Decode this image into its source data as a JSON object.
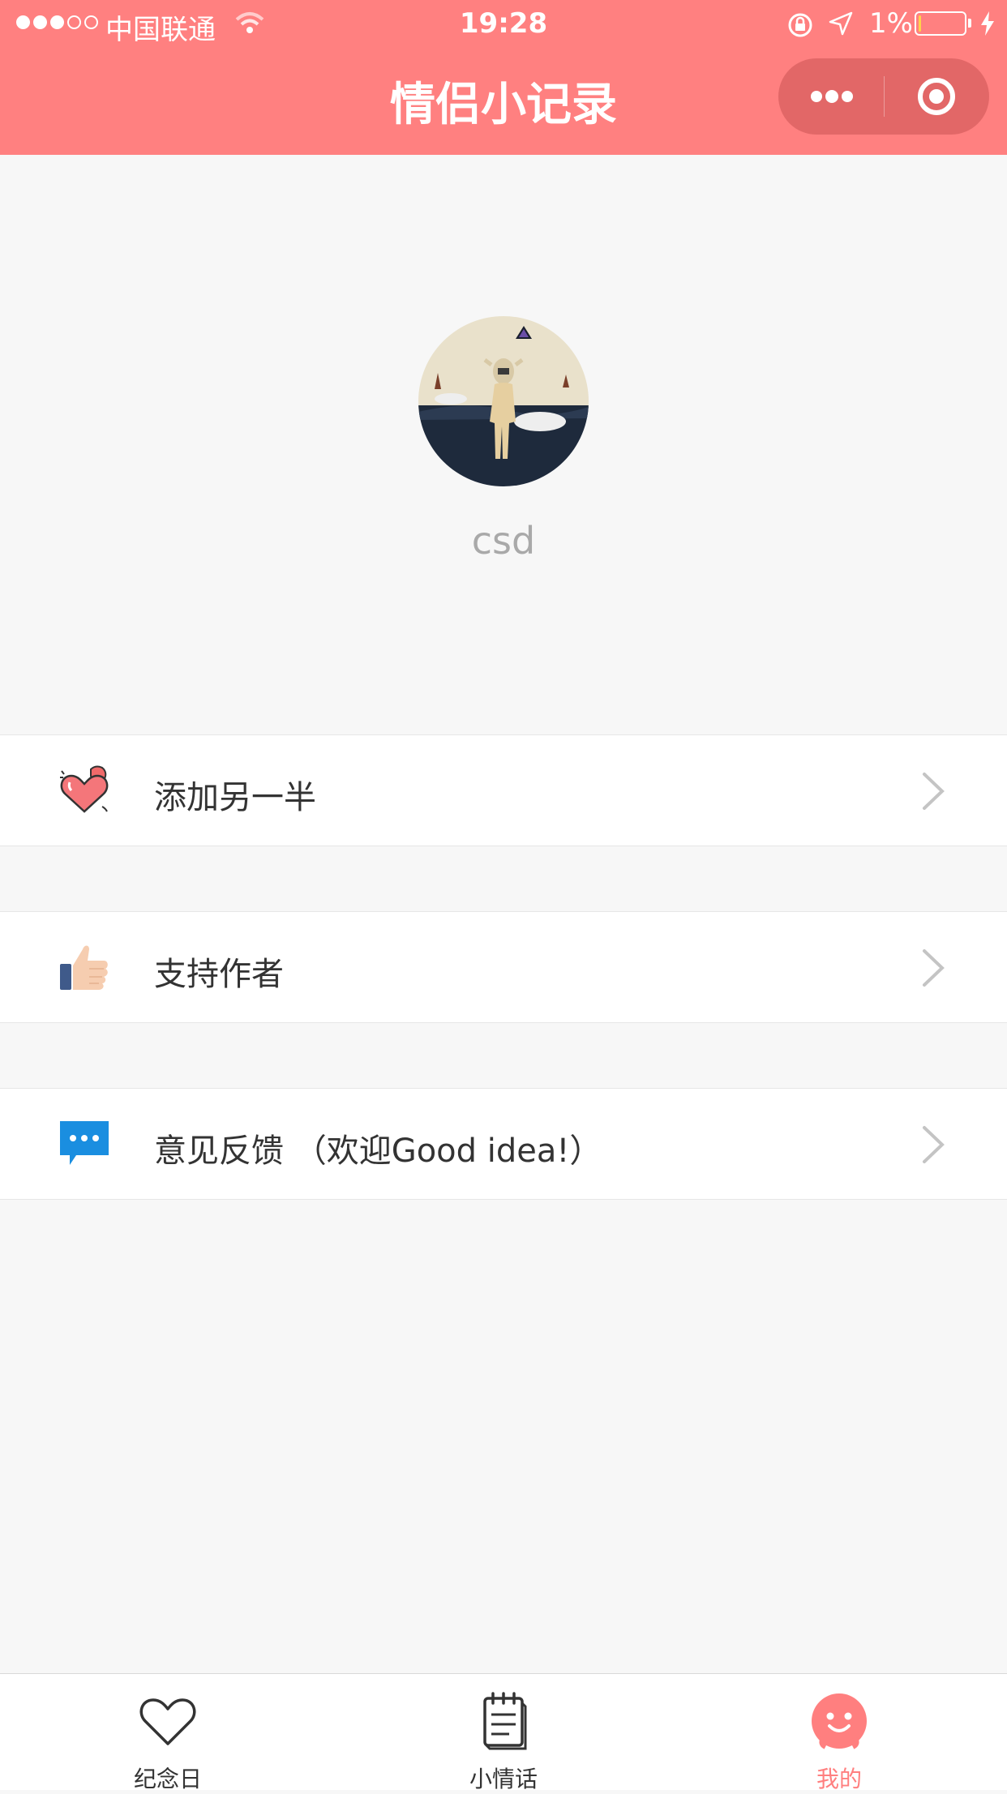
{
  "status_bar": {
    "carrier": "中国联通",
    "time": "19:28",
    "battery_percent": "1%",
    "battery_level": 0.01
  },
  "nav": {
    "title": "情侣小记录",
    "more_icon": "more-dots-icon",
    "close_icon": "target-close-icon"
  },
  "profile": {
    "username": "csd"
  },
  "menu": {
    "items": [
      {
        "label": "添加另一半",
        "icon": "hearts-icon"
      },
      {
        "label": "支持作者",
        "icon": "thumbs-up-icon"
      },
      {
        "label": "意见反馈 （欢迎Good idea!）",
        "icon": "chat-bubble-icon"
      }
    ]
  },
  "tabbar": {
    "tabs": [
      {
        "label": "纪念日",
        "icon": "heart-outline-icon"
      },
      {
        "label": "小情话",
        "icon": "notebook-icon"
      },
      {
        "label": "我的",
        "icon": "smiley-face-icon"
      }
    ],
    "active_index": 2
  },
  "colors": {
    "brand": "#ff8080",
    "active_tab": "#ff7f7f",
    "background": "#f7f7f7",
    "username_text": "#a9a9a9"
  }
}
